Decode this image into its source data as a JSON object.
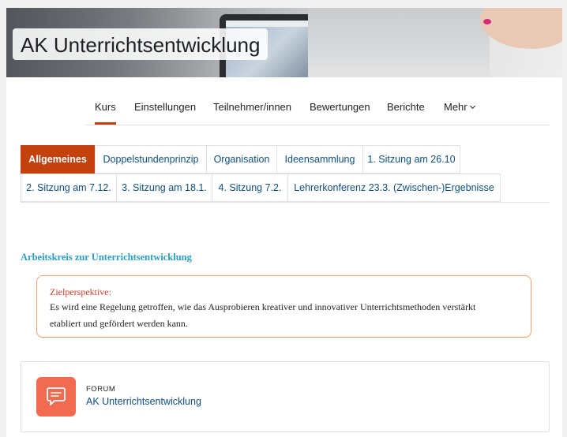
{
  "course": {
    "title": "AK Unterrichtsentwicklung"
  },
  "secondary_nav": {
    "items": [
      {
        "label": "Kurs",
        "active": true
      },
      {
        "label": "Einstellungen"
      },
      {
        "label": "Teilnehmer/innen"
      },
      {
        "label": "Bewertungen"
      },
      {
        "label": "Berichte"
      },
      {
        "label": "Mehr"
      }
    ]
  },
  "section_tabs": {
    "row1": [
      {
        "label": "Allgemeines",
        "active": true
      },
      {
        "label": "Doppelstundenprinzip"
      },
      {
        "label": "Organisation"
      },
      {
        "label": "Ideensammlung"
      },
      {
        "label": "1. Sitzung am 26.10"
      }
    ],
    "row2": [
      {
        "label": "2. Sitzung am 7.12."
      },
      {
        "label": "3. Sitzung am 18.1."
      },
      {
        "label": "4. Sitzung 7.2."
      },
      {
        "label": "Lehrerkonferenz 23.3. (Zwischen-)Ergebnisse"
      }
    ]
  },
  "content": {
    "heading": "Arbeitskreis zur Unterrichtsentwicklung",
    "goal": {
      "title": "Zielperspektive:",
      "line1": "Es wird eine Regelung getroffen, wie das Ausprobieren kreativer und innovativer Unterrichtsmethoden verstärkt",
      "line2": "etabliert und gefördert werden kann."
    },
    "activity": {
      "type": "FORUM",
      "name": "AK Unterrichtsentwicklung",
      "icon": "forum-icon"
    }
  },
  "colors": {
    "accent": "#c2410c",
    "link": "#0f4f80",
    "forum": "#f26a4f",
    "heading": "#2a9fc4",
    "goal_border": "#f0a06e",
    "goal_title": "#d13c2a"
  }
}
